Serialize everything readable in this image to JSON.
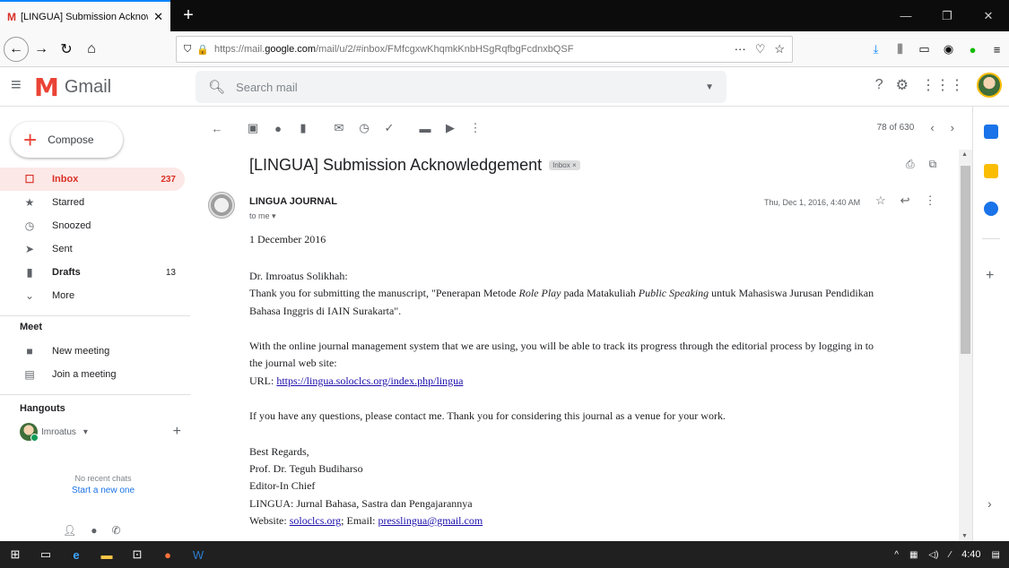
{
  "browser": {
    "tab_title": "[LINGUA] Submission Acknowl",
    "url_prefix": "https://mail.",
    "url_host": "google.com",
    "url_path": "/mail/u/2/#inbox/FMfcgxwKhqmkKnbHSgRqfbgFcdnxbQSF"
  },
  "gmail": {
    "brand": "Gmail",
    "search_placeholder": "Search mail",
    "compose_label": "Compose",
    "nav": [
      {
        "label": "Inbox",
        "count": "237",
        "icon": "inbox-icon"
      },
      {
        "label": "Starred",
        "count": "",
        "icon": "star-icon"
      },
      {
        "label": "Snoozed",
        "count": "",
        "icon": "clock-icon"
      },
      {
        "label": "Sent",
        "count": "",
        "icon": "send-icon"
      },
      {
        "label": "Drafts",
        "count": "13",
        "icon": "draft-icon"
      },
      {
        "label": "More",
        "count": "",
        "icon": "chevron-down-icon"
      }
    ],
    "meet": {
      "heading": "Meet",
      "new_meeting": "New meeting",
      "join_meeting": "Join a meeting"
    },
    "hangouts": {
      "heading": "Hangouts",
      "user": "Imroatus",
      "no_recent": "No recent chats",
      "start_new": "Start a new one"
    },
    "pager": "78 of 630"
  },
  "email": {
    "subject": "[LINGUA] Submission Acknowledgement",
    "label_chip": "Inbox ×",
    "sender": "LINGUA JOURNAL",
    "to": "to me ▾",
    "date": "Thu, Dec 1, 2016, 4:40 AM",
    "body": {
      "date_line": "1 December 2016",
      "salutation": "Dr. Imroatus Solikhah:",
      "thanks_1": "Thank you for submitting the manuscript,  \"Penerapan Metode ",
      "thanks_em1": "Role Play",
      "thanks_2": " pada Matakuliah ",
      "thanks_em2": "Public Speaking",
      "thanks_3": " untuk Mahasiswa Jurusan Pendidikan",
      "thanks_line2": "Bahasa Inggris di IAIN Surakarta\".",
      "system_line1": "With the online journal management system that we are using, you will be able to track its progress through the editorial process by logging in to",
      "system_line2": "the journal web site:",
      "url_label": "URL: ",
      "url_link": "https://lingua.soloclcs.org/index.php/lingua",
      "questions": "If you have any questions, please contact me. Thank you for considering this journal as a venue for your work.",
      "regards": "Best Regards,",
      "signer": "Prof. Dr. Teguh Budiharso",
      "role": "Editor-In Chief",
      "journal": "LINGUA: Jurnal Bahasa, Sastra dan Pengajarannya",
      "website_label": "Website: ",
      "website_link": "soloclcs.org",
      "email_label": ";  Email: ",
      "email_link": "presslingua@gmail.com"
    }
  },
  "taskbar": {
    "clock": "4:40"
  }
}
